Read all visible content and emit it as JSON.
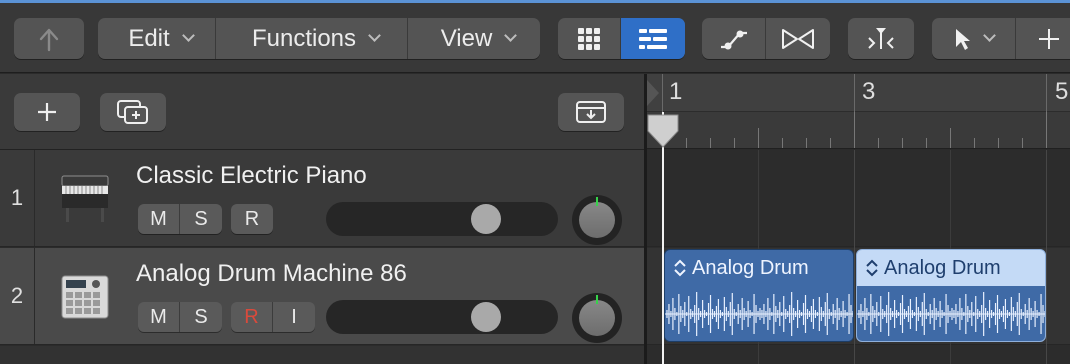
{
  "toolbar": {
    "edit_label": "Edit",
    "functions_label": "Functions",
    "view_label": "View"
  },
  "tracks": [
    {
      "number": "1",
      "name": "Classic Electric Piano",
      "mute": "M",
      "solo": "S",
      "record": "R",
      "volume": 0.73
    },
    {
      "number": "2",
      "name": "Analog Drum Machine 86",
      "mute": "M",
      "solo": "S",
      "record": "R",
      "input": "I",
      "volume": 0.73
    }
  ],
  "ruler": {
    "bars": [
      "1",
      "3",
      "5"
    ]
  },
  "regions": [
    {
      "name": "Analog Drum",
      "selected": false
    },
    {
      "name": "Analog Drum",
      "selected": true
    }
  ],
  "colors": {
    "accent": "#2f6fc7",
    "region": "#3f6aa6",
    "region_selected_header": "#c4daf6",
    "record_red": "#d94a3c",
    "pan_indicator": "#37d24b"
  }
}
